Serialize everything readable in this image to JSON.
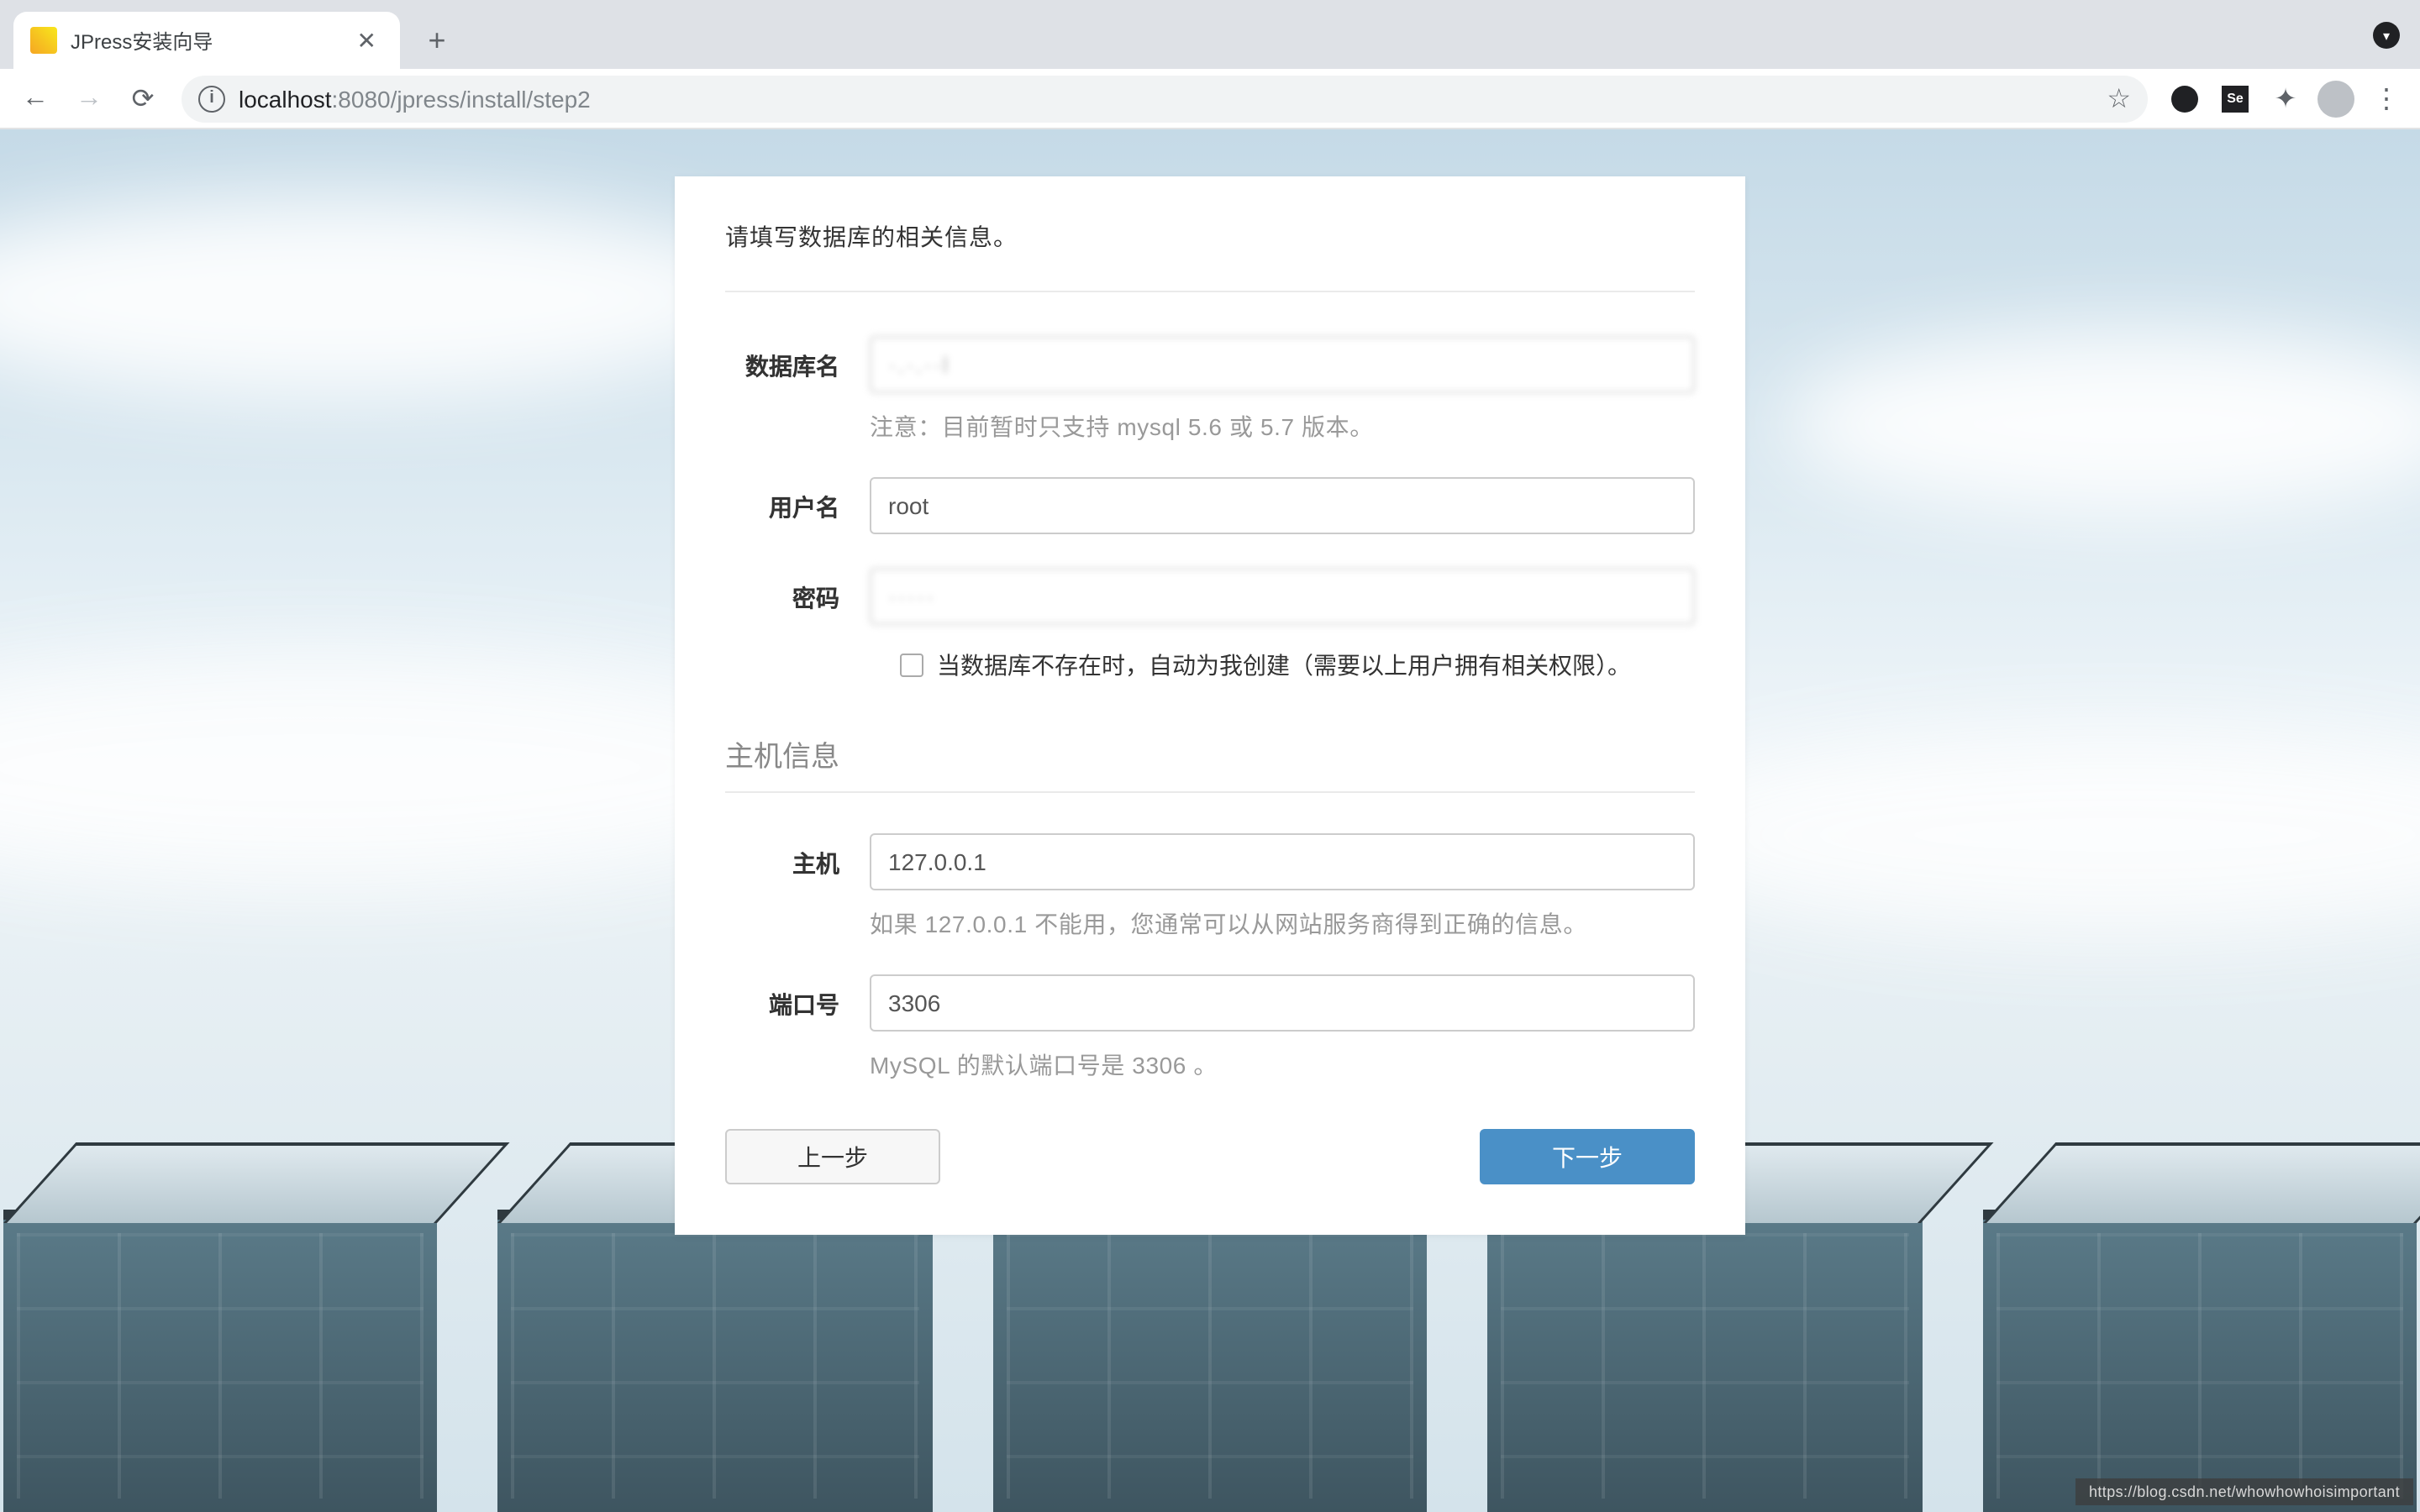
{
  "browser": {
    "tab_title": "JPress安装向导",
    "url_host": "localhost",
    "url_port_path": ":8080/jpress/install/step2",
    "se_badge": "Se"
  },
  "form": {
    "intro": "请填写数据库的相关信息。",
    "db_name_label": "数据库名",
    "db_name_value": "·.·.··l",
    "db_name_hint": "注意：目前暂时只支持 mysql 5.6 或 5.7 版本。",
    "user_label": "用户名",
    "user_value": "root",
    "pwd_label": "密码",
    "pwd_value": "·····",
    "auto_create_label": "当数据库不存在时，自动为我创建（需要以上用户拥有相关权限）。",
    "host_section": "主机信息",
    "host_label": "主机",
    "host_value": "127.0.0.1",
    "host_hint": "如果 127.0.0.1 不能用，您通常可以从网站服务商得到正确的信息。",
    "port_label": "端口号",
    "port_value": "3306",
    "port_hint": "MySQL 的默认端口号是 3306 。",
    "prev_btn": "上一步",
    "next_btn": "下一步"
  },
  "watermark": "https://blog.csdn.net/whowhowhoisimportant"
}
